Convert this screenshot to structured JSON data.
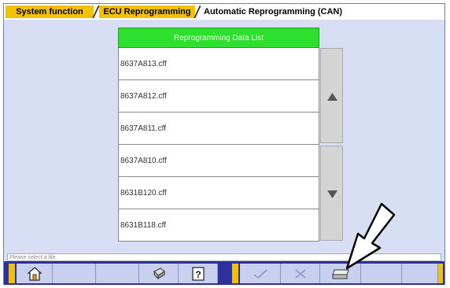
{
  "tabs": {
    "system_function": "System function",
    "ecu_reprogramming": "ECU Reprogramming",
    "automatic_reprogramming": "Automatic Reprogramming (CAN)"
  },
  "list": {
    "header": "Reprogramming Data List",
    "items": [
      "8637A813.cff",
      "8637A812.cff",
      "8637A811.cff",
      "8637A810.cff",
      "8631B120.cff",
      "8631B118.cff"
    ]
  },
  "status": {
    "message": "Please select a file."
  },
  "toolbar": {
    "home_icon": "home-icon",
    "print_icon": "printer-icon",
    "help_icon": "help-icon",
    "ok_icon": "check-icon",
    "cancel_icon": "cross-icon",
    "drive_icon": "drive-icon"
  },
  "colors": {
    "tab_active": "#f2c200",
    "header_green": "#2ee02e",
    "toolbar_blue": "#2b2fa0",
    "panel_bg": "#d8def4"
  }
}
